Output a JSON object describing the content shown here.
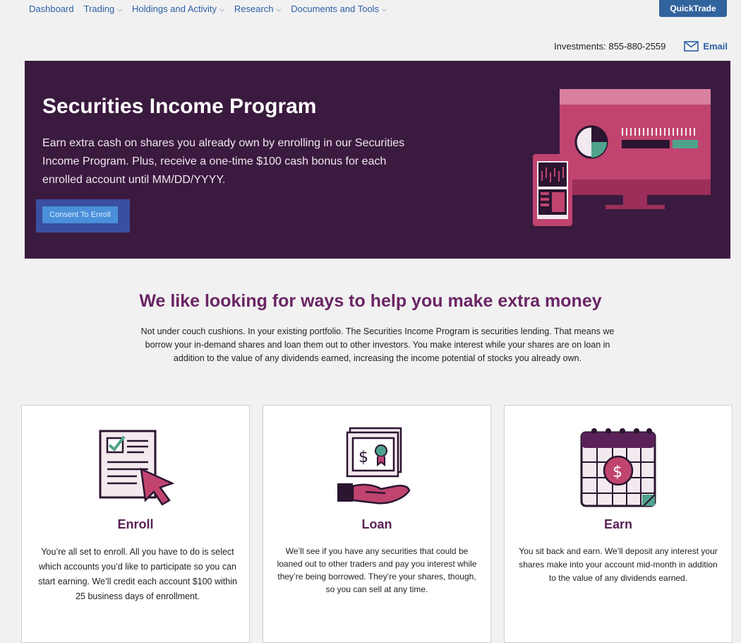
{
  "nav": {
    "items": [
      {
        "label": "Dashboard",
        "dropdown": false
      },
      {
        "label": "Trading",
        "dropdown": true
      },
      {
        "label": "Holdings and Activity",
        "dropdown": true
      },
      {
        "label": "Research",
        "dropdown": true
      },
      {
        "label": "Documents and Tools",
        "dropdown": true
      }
    ],
    "quicktrade_label": "QuickTrade"
  },
  "contact": {
    "phone": "Investments: 855-880-2559",
    "email_label": "Email"
  },
  "hero": {
    "title": "Securities Income Program",
    "body": "Earn extra cash on shares you already own by enrolling in our Securities Income Program. Plus, receive a one-time $100 cash bonus for each enrolled account until MM/DD/YYYY.",
    "cta_label": "Consent To Enroll"
  },
  "intro": {
    "title": "We like looking for ways to help you make extra money",
    "text": "Not under couch cushions. In your existing portfolio. The Securities Income Program is securities lending. That means we borrow your in-demand shares and loan them out to other investors. You make interest while your shares are on loan in addition to the value of any dividends earned, increasing the income potential of stocks you already own."
  },
  "cards": [
    {
      "title": "Enroll",
      "icon": "enroll-form-cursor-icon",
      "text": "You’re all set to enroll. All you have to do is select which accounts you’d like to participate so you can start earning. We’ll credit each account $100 within 25 business days of enrollment."
    },
    {
      "title": "Loan",
      "icon": "certificate-hand-icon",
      "text": "We’ll see if you have any securities that could be loaned out to other traders and pay you interest while they’re being borrowed. They’re your shares, though, so you can sell at any time."
    },
    {
      "title": "Earn",
      "icon": "calendar-dollar-icon",
      "text": "You sit back and earn. We’ll deposit any interest your shares make into your account mid-month in addition to the value of any dividends earned."
    }
  ],
  "colors": {
    "hero_bg": "#3b1a3f",
    "accent_purple": "#6b2565",
    "link_blue": "#2d5fa6",
    "icon_pink": "#c0446f"
  }
}
